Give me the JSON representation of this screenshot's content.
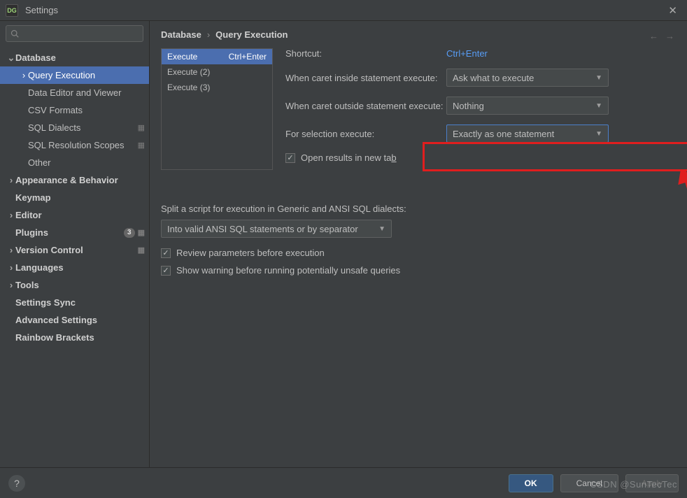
{
  "window": {
    "app_badge": "DG",
    "title": "Settings",
    "close_glyph": "✕"
  },
  "search": {
    "placeholder": ""
  },
  "breadcrumb": {
    "root": "Database",
    "leaf": "Query Execution",
    "sep": "›",
    "back_glyph": "←",
    "fwd_glyph": "→"
  },
  "sidebar": {
    "items": [
      {
        "label": "Database",
        "level": 0,
        "expanded": true
      },
      {
        "label": "Query Execution",
        "level": 1,
        "selected": true
      },
      {
        "label": "Data Editor and Viewer",
        "level": 1
      },
      {
        "label": "CSV Formats",
        "level": 1
      },
      {
        "label": "SQL Dialects",
        "level": 1,
        "gear": true
      },
      {
        "label": "SQL Resolution Scopes",
        "level": 1,
        "gear": true
      },
      {
        "label": "Other",
        "level": 1
      },
      {
        "label": "Appearance & Behavior",
        "level": 0,
        "collapsed": true
      },
      {
        "label": "Keymap",
        "level": 0
      },
      {
        "label": "Editor",
        "level": 0,
        "collapsed": true
      },
      {
        "label": "Plugins",
        "level": 0,
        "badge": "3",
        "gear": true
      },
      {
        "label": "Version Control",
        "level": 0,
        "collapsed": true,
        "gear": true
      },
      {
        "label": "Languages",
        "level": 0,
        "collapsed": true
      },
      {
        "label": "Tools",
        "level": 0,
        "collapsed": true
      },
      {
        "label": "Settings Sync",
        "level": 0
      },
      {
        "label": "Advanced Settings",
        "level": 0
      },
      {
        "label": "Rainbow Brackets",
        "level": 0
      }
    ]
  },
  "exec_list": [
    {
      "label": "Execute",
      "shortcut": "Ctrl+Enter",
      "selected": true
    },
    {
      "label": "Execute (2)",
      "shortcut": ""
    },
    {
      "label": "Execute (3)",
      "shortcut": ""
    }
  ],
  "form": {
    "shortcut_label": "Shortcut:",
    "shortcut_value": "Ctrl+Enter",
    "caret_inside_label": "When caret inside statement execute:",
    "caret_inside_value": "Ask what to execute",
    "caret_outside_label": "When caret outside statement execute:",
    "caret_outside_value": "Nothing",
    "selection_label": "For selection execute:",
    "selection_value": "Exactly as one statement",
    "open_results_label": "Open results in new tab",
    "open_results_checked": true
  },
  "section2": {
    "split_label": "Split a script for execution in Generic and ANSI SQL dialects:",
    "split_value": "Into valid ANSI SQL statements or by separator",
    "review_label": "Review parameters before execution",
    "review_checked": true,
    "warn_label": "Show warning before running potentially unsafe queries",
    "warn_checked": true
  },
  "footer": {
    "help": "?",
    "ok": "OK",
    "cancel": "Cancel",
    "apply": "Apply"
  },
  "watermark": "CSDN @SunTecTec"
}
